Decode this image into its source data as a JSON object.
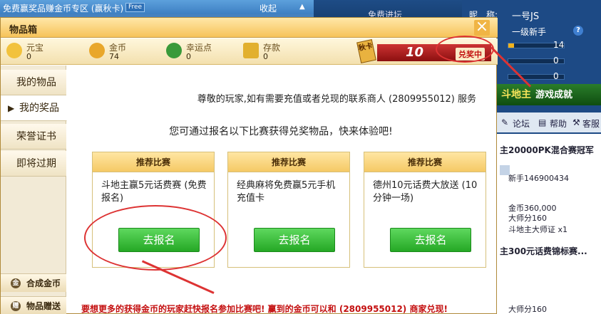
{
  "background": {
    "top_title": "免费赢奖品赚金币专区 (赢秋卡)",
    "top_badge": "Free",
    "collapse": "收起",
    "collapse_arrow": "▲",
    "mid_tab": "免费进坛",
    "profile": {
      "nickname_label": "昵　称:",
      "nickname": "一号JS",
      "rank": "一级新手",
      "help_icon": "?",
      "bar1_value": "14",
      "bar1_fill": 0.1,
      "bar2_value": "0",
      "bar3_value": "0"
    },
    "banner": "斗地主",
    "banner_sub": "游戏成就",
    "toolbar": {
      "forum": "论坛",
      "help": "帮助",
      "service": "客服"
    },
    "feed": {
      "title1": "主20000PK混合赛冠军",
      "user1": "新手146900434",
      "coins": "金币360,000",
      "master": "大师分160",
      "badge": "斗地主大师证 x1",
      "title2": "主300元话费锦标赛...",
      "master2": "大师分160"
    }
  },
  "dialog": {
    "title": "物品箱",
    "close": "×",
    "currencies": [
      {
        "label": "元宝",
        "value": "0",
        "color": "#f2c23c"
      },
      {
        "label": "金币",
        "value": "74",
        "color": "#e9a72a"
      },
      {
        "label": "幸运点",
        "value": "0",
        "color": "#3a9a3a"
      },
      {
        "label": "存款",
        "value": "0",
        "color": "#e2b02e"
      }
    ],
    "lottery": {
      "card": "秋卡",
      "count": "10",
      "redeem": "兑奖中"
    },
    "tabs": [
      {
        "label": "我的物品",
        "active": false
      },
      {
        "label": "我的奖品",
        "active": true
      },
      {
        "label": "荣誉证书",
        "active": false
      },
      {
        "label": "即将过期",
        "active": false
      }
    ],
    "active_caret": "▶",
    "side_buttons": [
      {
        "label": "合成金币",
        "icon": "coin-icon",
        "glyph": "金"
      },
      {
        "label": "物品赠送",
        "icon": "gift-icon",
        "glyph": "赠"
      }
    ],
    "notice": "尊敬的玩家,如有需要充值或者兑现的联系商人 (2809955012) 服务",
    "invite": "您可通过报名以下比赛获得兑奖物品，快来体验吧!",
    "matches": [
      {
        "header": "推荐比赛",
        "desc": "斗地主赢5元话费赛 (免费报名)",
        "button": "去报名"
      },
      {
        "header": "推荐比赛",
        "desc": "经典麻将免费赢5元手机充值卡",
        "button": "去报名"
      },
      {
        "header": "推荐比赛",
        "desc": "德州10元话费大放送 (10分钟一场)",
        "button": "去报名"
      }
    ],
    "bottom_message": "要想更多的获得金币的玩家赶快报名参加比赛吧! 赢到的金币可以和 (2809955012) 商家兑现!"
  },
  "colors": {
    "accent": "#f5c965",
    "go_button": "#25a825",
    "annotation": "#dd3333"
  }
}
